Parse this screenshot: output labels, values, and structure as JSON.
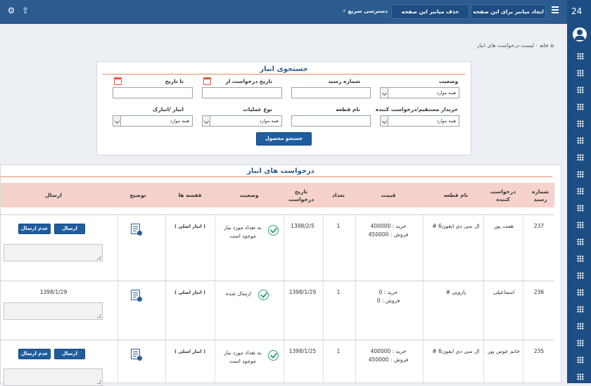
{
  "topbar": {
    "create_shortcut": "ایجاد میانبر برای این صفحه",
    "delete_shortcut": "حذف میانبر این صفحه",
    "quick_access": "دسترسی سریع"
  },
  "rail": {
    "brand": "24"
  },
  "breadcrumb": {
    "home": "خانه",
    "current": "لیست درخواست های انبار"
  },
  "search": {
    "title": "جستجوی انبار",
    "status_label": "وضعیت",
    "status_value": "همه موارد",
    "receipt_label": "شماره رسید",
    "date_from_label": "تاریخ درخواست از",
    "date_to_label": "تا تاریخ",
    "buyer_label": "خریدار مستقیم/درخواست کننده",
    "buyer_value": "همه موارد",
    "part_label": "نام قطعه",
    "operation_label": "نوع عملیات",
    "operation_value": "همه موارد",
    "warehouse_label": "انبار /انبارک",
    "warehouse_value": "همه موارد",
    "submit": "جستجو محصول"
  },
  "table": {
    "title": "درخواست های انبار",
    "columns": {
      "receipt": "شماره رسید",
      "requester": "درخواست کننده",
      "part": "نام قطعه",
      "price": "قیمت",
      "count": "تعداد",
      "date": "تاریخ درخواست",
      "status": "وضعیت",
      "shelf": "قفسه ها",
      "desc": "توضیح",
      "send": "ارسال"
    },
    "rows": [
      {
        "receipt": "237",
        "requester": "همت پور",
        "part": "ال سی دی ایفون6 #",
        "buy": "خرید : 400000",
        "sell": "فروش : 450000",
        "count": "1",
        "date": "1398/2/5",
        "status": "به تعداد مورد نیاز موجود است",
        "shelf": "( انبار اصلی )",
        "send_btn": "ارسال",
        "nosend_btn": "عدم ارسال",
        "sent_date": ""
      },
      {
        "receipt": "236",
        "requester": "اسماعیلی",
        "part": "پارویی #",
        "buy": "خرید : 0",
        "sell": "فروش : 0",
        "count": "1",
        "date": "1398/1/29",
        "status": "ارسال شده",
        "shelf": "( انبار اصلی )",
        "send_btn": "",
        "nosend_btn": "",
        "sent_date": "1398/1/29"
      },
      {
        "receipt": "235",
        "requester": "خانم عوض پور",
        "part": "ال سی دی ایفون6 #",
        "buy": "خرید : 400000",
        "sell": "فروش : 450000",
        "count": "1",
        "date": "1398/1/25",
        "status": "به تعداد مورد نیاز موجود است",
        "shelf": "( انبار اصلی )",
        "send_btn": "ارسال",
        "nosend_btn": "عدم ارسال",
        "sent_date": ""
      }
    ]
  }
}
